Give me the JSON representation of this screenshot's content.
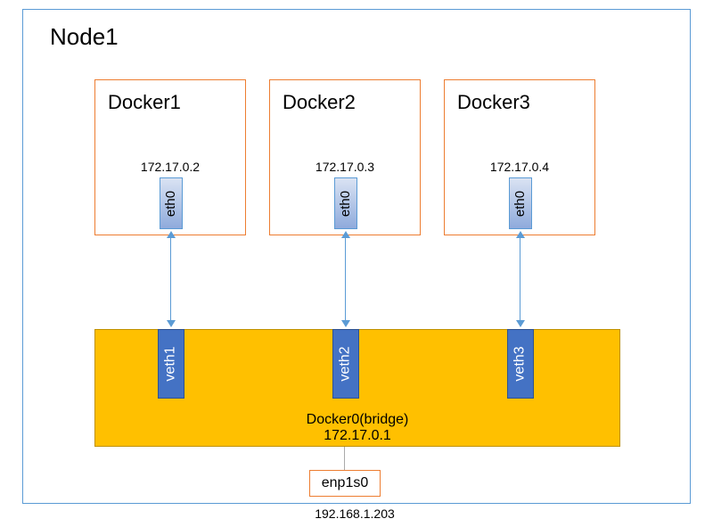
{
  "node": {
    "title": "Node1"
  },
  "dockers": [
    {
      "title": "Docker1",
      "ip": "172.17.0.2",
      "eth": "eth0",
      "veth": "veth1"
    },
    {
      "title": "Docker2",
      "ip": "172.17.0.3",
      "eth": "eth0",
      "veth": "veth2"
    },
    {
      "title": "Docker3",
      "ip": "172.17.0.4",
      "eth": "eth0",
      "veth": "veth3"
    }
  ],
  "bridge": {
    "title": "Docker0(bridge)",
    "ip": "172.17.0.1"
  },
  "nic": {
    "name": "enp1s0",
    "ip": "192.168.1.203"
  }
}
